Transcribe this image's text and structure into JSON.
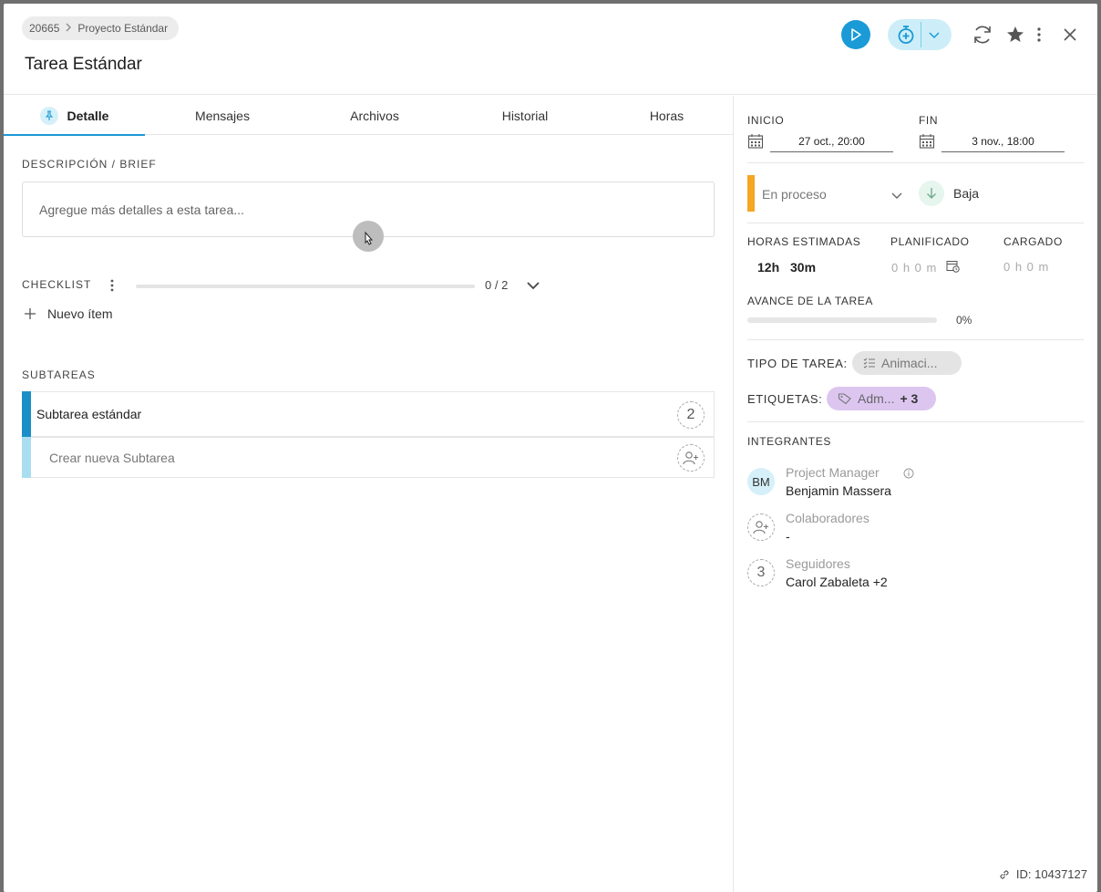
{
  "header": {
    "breadcrumb": {
      "id": "20665",
      "project": "Proyecto Estándar"
    },
    "title": "Tarea Estándar"
  },
  "tabs": [
    {
      "label": "Detalle",
      "active": true
    },
    {
      "label": "Mensajes"
    },
    {
      "label": "Archivos"
    },
    {
      "label": "Historial"
    },
    {
      "label": "Horas"
    }
  ],
  "detail": {
    "description_label": "DESCRIPCIÓN / BRIEF",
    "description_placeholder": "Agregue más detalles a esta tarea...",
    "checklist_label": "CHECKLIST",
    "checklist_count": "0 / 2",
    "checklist_progress": 0,
    "new_item_label": "Nuevo ítem",
    "subtasks_label": "SUBTAREAS",
    "subtasks": [
      {
        "name": "Subtarea estándar",
        "count": "2",
        "color": "#1a8fc7"
      }
    ],
    "new_subtask_placeholder": "Crear nueva Subtarea",
    "new_subtask_color": "#a9def0"
  },
  "sidebar": {
    "start_label": "INICIO",
    "start_value": "27 oct., 20:00",
    "end_label": "FIN",
    "end_value": "3 nov., 18:00",
    "status": {
      "label": "En proceso",
      "color": "#f5a623"
    },
    "priority": {
      "label": "Baja"
    },
    "hours": {
      "estimated_label": "HORAS ESTIMADAS",
      "estimated_h": "12h",
      "estimated_m": "30m",
      "planned_label": "PLANIFICADO",
      "planned_value": "0 h 0 m",
      "charged_label": "CARGADO",
      "charged_value": "0 h 0 m"
    },
    "progress_label": "AVANCE DE LA TAREA",
    "progress_value": "0%",
    "progress_fraction": 0,
    "task_type_label": "TIPO DE TAREA:",
    "task_type_value": "Animaci...",
    "tags_label": "ETIQUETAS:",
    "tags_value": "Adm...",
    "tags_extra": "+ 3",
    "members_label": "INTEGRANTES",
    "members": {
      "pm_role": "Project Manager",
      "pm_initials": "BM",
      "pm_name": "Benjamin Massera",
      "collab_role": "Colaboradores",
      "collab_name": "-",
      "followers_role": "Seguidores",
      "followers_count": "3",
      "followers_name": "Carol Zabaleta +2"
    },
    "id_text": "ID: 10437127"
  },
  "colors": {
    "accent": "#1a9ad6",
    "timer_bg": "#cdeef9",
    "type_chip": "#e4e4e4",
    "tag_chip": "#dcc6f0"
  }
}
